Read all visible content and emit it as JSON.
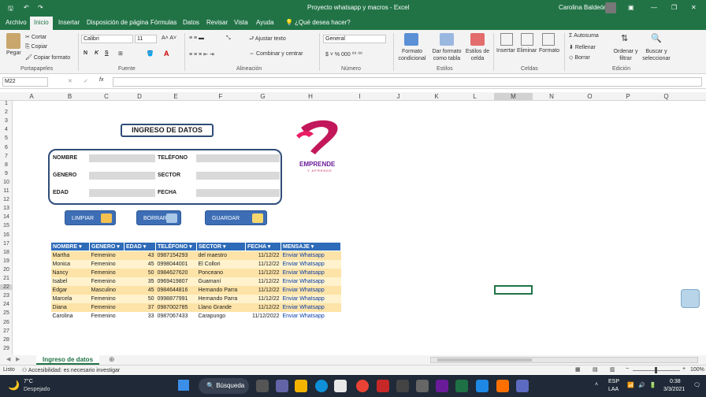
{
  "window": {
    "title": "Proyecto whatsapp y macros  -  Excel",
    "user": "Carolina Baldeón"
  },
  "tabs": [
    "Archivo",
    "Inicio",
    "Insertar",
    "Disposición de página",
    "Fórmulas",
    "Datos",
    "Revisar",
    "Vista",
    "Ayuda",
    "¿Qué desea hacer?"
  ],
  "ribbon": {
    "pegar": "Pegar",
    "cortar": "Cortar",
    "copiar": "Copiar",
    "copiar_formato": "Copiar formato",
    "portapapeles": "Portapapeles",
    "font_name": "Calibri",
    "font_size": "11",
    "fuente": "Fuente",
    "ajustar": "Ajustar texto",
    "combinar": "Combinar y centrar",
    "alineacion": "Alineación",
    "numformat": "General",
    "numero": "Número",
    "formato_cond": "Formato condicional",
    "dar_formato": "Dar formato como tabla",
    "estilos_celda": "Estilos de celda",
    "estilos": "Estilos",
    "insertar": "Insertar",
    "eliminar": "Eliminar",
    "formato": "Formato",
    "celdas": "Celdas",
    "autosuma": "Autosuma",
    "rellenar": "Rellenar",
    "borrar": "Borrar",
    "ordenar": "Ordenar y filtrar",
    "buscar": "Buscar y seleccionar",
    "edicion": "Edición"
  },
  "formula_bar": {
    "name_box": "M22",
    "fx": "fx"
  },
  "columns": [
    "A",
    "B",
    "C",
    "D",
    "E",
    "F",
    "G",
    "H",
    "I",
    "J",
    "K",
    "L",
    "M",
    "N",
    "O",
    "P",
    "Q"
  ],
  "rows": [
    "1",
    "2",
    "3",
    "4",
    "5",
    "6",
    "7",
    "8",
    "9",
    "10",
    "11",
    "12",
    "13",
    "14",
    "15",
    "16",
    "17",
    "18",
    "19",
    "20",
    "21",
    "22",
    "23",
    "24",
    "25",
    "26",
    "27",
    "28",
    "29"
  ],
  "form": {
    "title": "INGRESO DE DATOS",
    "labels": {
      "nombre": "NOMBRE",
      "genero": "GENERO",
      "edad": "EDAD",
      "telefono": "TELÉFONO",
      "sector": "SECTOR",
      "fecha": "FECHA"
    },
    "buttons": {
      "limpiar": "LIMPIAR",
      "borrar": "BORRAR",
      "guardar": "GUARDAR"
    }
  },
  "logo": {
    "line1": "EMPRENDE",
    "line2": "Y APRENDE"
  },
  "table": {
    "headers": [
      "NOMBRE",
      "GENERO",
      "EDAD",
      "TELÉFONO",
      "SECTOR",
      "FECHA",
      "MENSAJE"
    ],
    "rows": [
      [
        "Martha",
        "Femenino",
        "43",
        "0987154293",
        "del maestro",
        "11/12/22",
        "Enviar Whatsapp"
      ],
      [
        "Monica",
        "Femenino",
        "45",
        "0998044001",
        "El Collori",
        "11/12/22",
        "Enviar Whatsapp"
      ],
      [
        "Nancy",
        "Femenino",
        "50",
        "0984627620",
        "Ponceano",
        "11/12/22",
        "Enviar Whatsapp"
      ],
      [
        "Isabel",
        "Femenino",
        "35",
        "0969419807",
        "Guamaní",
        "11/12/22",
        "Enviar Whatsapp"
      ],
      [
        "Edgar",
        "Masculino",
        "45",
        "0984644816",
        "Hernando Parra",
        "11/12/22",
        "Enviar Whatsapp"
      ],
      [
        "Marcela",
        "Femenino",
        "50",
        "0998877991",
        "Hernando Parra",
        "11/12/22",
        "Enviar Whatsapp"
      ],
      [
        "Diana",
        "Femenino",
        "37",
        "0987002785",
        "Llano Grande",
        "11/12/22",
        "Enviar Whatsapp"
      ],
      [
        "Carolina",
        "Femenino",
        "33",
        "0987067433",
        "Carapungo",
        "11/12/2022",
        "Enviar Whatsapp"
      ]
    ]
  },
  "sheet_tab": "Ingreso de datos",
  "status": {
    "ready": "Listo",
    "accessibility": "Accesibilidad: es necesario investigar",
    "zoom": "100%"
  },
  "taskbar": {
    "weather_temp": "7°C",
    "weather_desc": "Despejado",
    "search": "Búsqueda",
    "lang": "ESP",
    "lang2": "LAA",
    "time": "0:38",
    "date": "3/3/2021"
  }
}
